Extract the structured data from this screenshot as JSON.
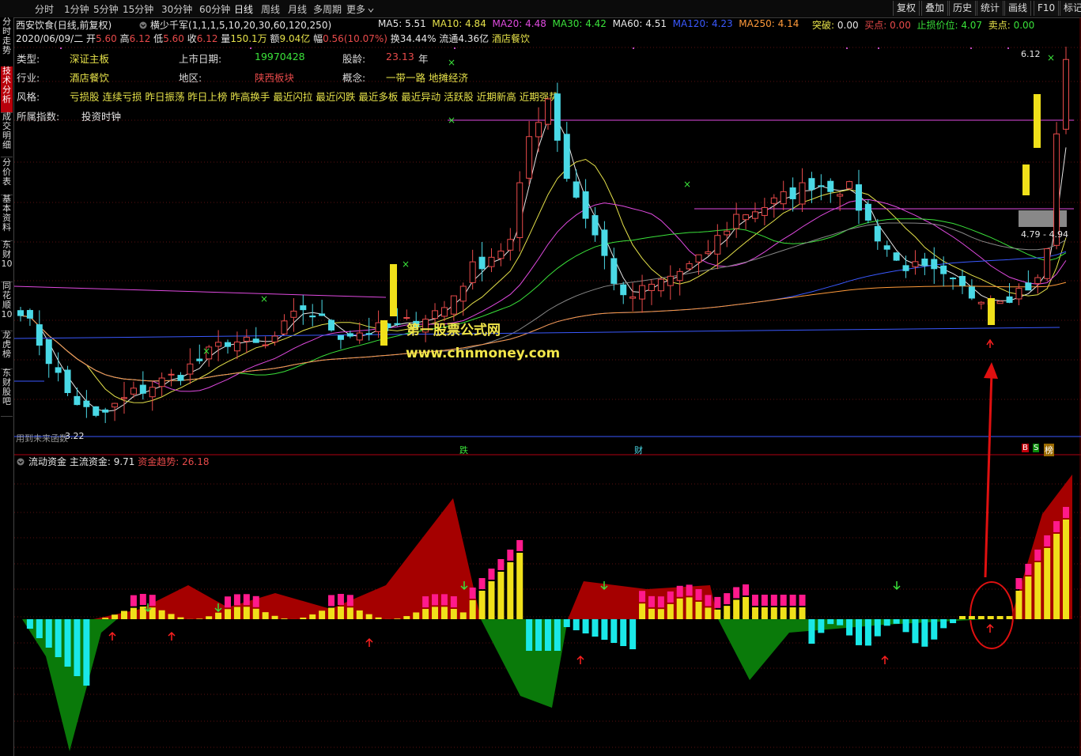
{
  "toolbar": {
    "periods": [
      "分时",
      "1分钟",
      "5分钟",
      "15分钟",
      "30分钟",
      "60分钟",
      "日线",
      "周线",
      "月线",
      "多周期",
      "更多"
    ],
    "active": "日线",
    "right_buttons": [
      "复权",
      "叠加",
      "历史",
      "统计",
      "画线",
      "F10",
      "标记"
    ]
  },
  "sidebar": {
    "tabs": [
      "分时走势",
      "技术分析",
      "成交明细",
      "分价表",
      "基本资料",
      "东财10",
      "同花顺10",
      "龙虎榜",
      "东财股吧"
    ],
    "active": "技术分析"
  },
  "header": {
    "stock_name": "西安饮食",
    "chart_mode": "(日线,前复权)",
    "indicator": "横少千军",
    "indicator_params": "(1,1,1,5,10,20,30,60,120,250)",
    "ma": [
      {
        "label": "MA5:",
        "value": "5.51",
        "color": "#e6e6e6"
      },
      {
        "label": "MA10:",
        "value": "4.84",
        "color": "#e6e24a"
      },
      {
        "label": "MA20:",
        "value": "4.48",
        "color": "#e04ae0"
      },
      {
        "label": "MA30:",
        "value": "4.42",
        "color": "#3ae23a"
      },
      {
        "label": "MA60:",
        "value": "4.51",
        "color": "#e6e6e6"
      },
      {
        "label": "MA120:",
        "value": "4.23",
        "color": "#3a59ff"
      },
      {
        "label": "MA250:",
        "value": "4.14",
        "color": "#ff9a3a"
      }
    ],
    "breakout_label": "突破:",
    "breakout_value": "0.00",
    "buy_label": "买点:",
    "buy_value": "0.00",
    "stoploss_label": "止损价位:",
    "stoploss_value": "4.07",
    "sell_label": "卖点:",
    "sell_value": "0.00"
  },
  "quote": {
    "date": "2020/06/09/二",
    "open_label": "开",
    "open": "5.60",
    "high_label": "高",
    "high": "6.12",
    "low_label": "低",
    "low": "5.60",
    "close_label": "收",
    "close": "6.12",
    "vol_label": "量",
    "vol": "150.1万",
    "amount_label": "额",
    "amount": "9.04亿",
    "change_label": "幅",
    "change": "0.56(10.07%)",
    "turnover_label": "换",
    "turnover": "34.44%",
    "float_label": "流通",
    "float": "4.36亿",
    "industry_tag": "酒店餐饮"
  },
  "info": {
    "type_label": "类型:",
    "type": "深证主板",
    "listdate_label": "上市日期:",
    "listdate": "19970428",
    "age_label": "股龄:",
    "age": "23.13",
    "age_unit": "年",
    "industry_label": "行业:",
    "industry": "酒店餐饮",
    "region_label": "地区:",
    "region": "陕西板块",
    "concept_label": "概念:",
    "concepts": "一带一路  地摊经济",
    "style_label": "风格:",
    "styles": "亏损股  连续亏损  昨日振荡  昨日上榜  昨高换手  最近闪拉  最近闪跌  最近多板  最近异动  活跃股  近期新高  近期强势",
    "index_label": "所属指数:",
    "index": "投资时钟"
  },
  "price_labels": {
    "high_mark": "6.12",
    "range_mark": "4.79 - 4.94",
    "low_mark": "3.22",
    "future_note": "用到未来函数"
  },
  "watermark": {
    "line1": "第一股票公式网",
    "line2": "www.chnmoney.com"
  },
  "event_markers": {
    "die": "跌",
    "cai": "财",
    "b": "B",
    "s": "S",
    "bang": "榜"
  },
  "sub_indicator": {
    "name": "流动资金",
    "main_label": "主流资金:",
    "main_value": "9.71",
    "trend_label": "资金趋势:",
    "trend_value": "26.18"
  },
  "colors": {
    "up": "#e84a4a",
    "down": "#4ad9e6",
    "red_fill": "#a50000",
    "green_fill": "#0a7a0a",
    "yellow": "#f0e01a",
    "magenta": "#ff1a8c",
    "cyan": "#1ae8e8"
  }
}
